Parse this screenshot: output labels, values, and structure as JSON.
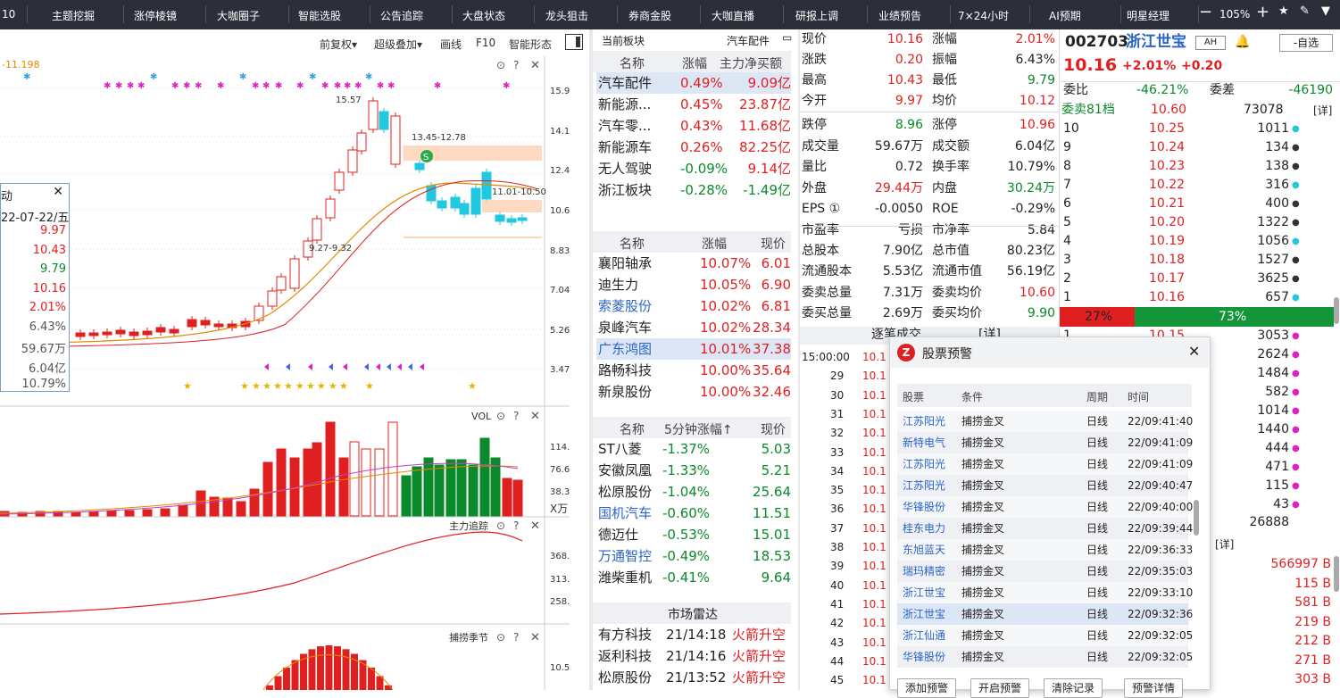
{
  "menu": [
    "10",
    "主题挖掘",
    "涨停棱镜",
    "大咖圈子",
    "智能选股",
    "公告追踪",
    "大盘状态",
    "龙头狙击",
    "券商金股",
    "大咖直播",
    "研报上调",
    "业绩预告",
    "7×24小时",
    "AI预期",
    "明星经理"
  ],
  "zoom": {
    "minus": "−",
    "level": "105%",
    "plus": "+"
  },
  "chart": {
    "tools": [
      "前复权▾",
      "超级叠加▾",
      "画线",
      "F10",
      "智能形态"
    ],
    "ma_label": "-11.198",
    "price_axis": [
      "15.97",
      "14.18",
      "12.40",
      "10.61",
      "8.83",
      "7.04",
      "5.26",
      "3.47"
    ],
    "annot": {
      "high": "15.57",
      "range1": "13.45-12.78",
      "range2": "11.01-10.50",
      "range3": "9.27-9.32"
    },
    "vol_label": "VOL",
    "vol_axis": [
      "114.97",
      "76.65",
      "38.32"
    ],
    "vol_unit": "X万",
    "zlzz_label": "主力追踪",
    "zlzz_axis": [
      "368.27",
      "313.43",
      "258.59"
    ],
    "blj_label": "捕捞季节",
    "blj_axis": [
      "10.50"
    ],
    "tooltip": {
      "title": "动",
      "date": "22-07-22/五",
      "vals": [
        {
          "v": "9.97",
          "c": "red"
        },
        {
          "v": "10.43",
          "c": "red"
        },
        {
          "v": "9.79",
          "c": "green"
        },
        {
          "v": "10.16",
          "c": "red"
        },
        {
          "v": "2.01%",
          "c": "red"
        },
        {
          "v": "6.43%",
          "c": "gray"
        },
        {
          "v": "59.67万",
          "c": "gray"
        },
        {
          "v": "6.04亿",
          "c": "gray"
        },
        {
          "v": "10.79%",
          "c": "gray"
        }
      ]
    }
  },
  "sector": {
    "title": "当前板块",
    "tag": "汽车配件",
    "cols": [
      "名称",
      "涨幅",
      "主力净买额"
    ],
    "rows": [
      {
        "n": "汽车配件",
        "p": "0.49%",
        "v": "9.09亿",
        "pc": "red",
        "vc": "red",
        "hl": true
      },
      {
        "n": "新能源...",
        "p": "0.45%",
        "v": "23.87亿",
        "pc": "red",
        "vc": "red"
      },
      {
        "n": "汽车零...",
        "p": "0.43%",
        "v": "11.68亿",
        "pc": "red",
        "vc": "red"
      },
      {
        "n": "新能源车",
        "p": "0.26%",
        "v": "82.25亿",
        "pc": "red",
        "vc": "red"
      },
      {
        "n": "无人驾驶",
        "p": "-0.09%",
        "v": "9.14亿",
        "pc": "green",
        "vc": "red"
      },
      {
        "n": "浙江板块",
        "p": "-0.28%",
        "v": "-1.49亿",
        "pc": "green",
        "vc": "green"
      }
    ]
  },
  "gainers": {
    "cols": [
      "名称",
      "涨幅",
      "现价"
    ],
    "rows": [
      {
        "n": "襄阳轴承",
        "p": "10.07%",
        "v": "6.01",
        "nc": ""
      },
      {
        "n": "迪生力",
        "p": "10.05%",
        "v": "6.90",
        "nc": ""
      },
      {
        "n": "索菱股份",
        "p": "10.02%",
        "v": "6.81",
        "nc": "blue"
      },
      {
        "n": "泉峰汽车",
        "p": "10.02%",
        "v": "28.34",
        "nc": ""
      },
      {
        "n": "广东鸿图",
        "p": "10.01%",
        "v": "37.38",
        "nc": "blue",
        "hl": true
      },
      {
        "n": "路畅科技",
        "p": "10.00%",
        "v": "35.64",
        "nc": ""
      },
      {
        "n": "新泉股份",
        "p": "10.00%",
        "v": "32.46",
        "nc": ""
      }
    ]
  },
  "fallers": {
    "cols": [
      "名称",
      "5分钟涨幅↑",
      "现价"
    ],
    "rows": [
      {
        "n": "ST八菱",
        "p": "-1.37%",
        "v": "5.03",
        "nc": ""
      },
      {
        "n": "安徽凤凰",
        "p": "-1.33%",
        "v": "5.21",
        "nc": ""
      },
      {
        "n": "松原股份",
        "p": "-1.04%",
        "v": "25.64",
        "nc": ""
      },
      {
        "n": "国机汽车",
        "p": "-0.60%",
        "v": "11.51",
        "nc": "blue"
      },
      {
        "n": "德迈仕",
        "p": "-0.53%",
        "v": "15.01",
        "nc": ""
      },
      {
        "n": "万通智控",
        "p": "-0.49%",
        "v": "18.53",
        "nc": "blue"
      },
      {
        "n": "潍柴重机",
        "p": "-0.41%",
        "v": "9.64",
        "nc": ""
      }
    ]
  },
  "radar": {
    "title": "市场雷达",
    "rows": [
      {
        "n": "有方科技",
        "t": "21/14:18",
        "e": "火箭升空"
      },
      {
        "n": "返利科技",
        "t": "21/14:16",
        "e": "火箭升空"
      },
      {
        "n": "松原股份",
        "t": "21/13:52",
        "e": "火箭升空"
      }
    ]
  },
  "quote": {
    "left": [
      {
        "k": "现价",
        "v": "10.16",
        "c": "red"
      },
      {
        "k": "涨跌",
        "v": "0.20",
        "c": "red"
      },
      {
        "k": "最高",
        "v": "10.43",
        "c": "red"
      },
      {
        "k": "今开",
        "v": "9.97",
        "c": "red"
      },
      {
        "k": "跌停",
        "v": "8.96",
        "c": "green"
      },
      {
        "k": "成交量",
        "v": "59.67万",
        "c": ""
      },
      {
        "k": "量比",
        "v": "0.72",
        "c": ""
      },
      {
        "k": "外盘",
        "v": "29.44万",
        "c": "red"
      },
      {
        "k": "EPS ①",
        "v": "-0.0050",
        "c": ""
      },
      {
        "k": "市盈率",
        "v": "亏损",
        "c": ""
      },
      {
        "k": "总股本",
        "v": "7.90亿",
        "c": ""
      },
      {
        "k": "流通股本",
        "v": "5.53亿",
        "c": ""
      },
      {
        "k": "委卖总量",
        "v": "7.31万",
        "c": ""
      },
      {
        "k": "委买总量",
        "v": "2.69万",
        "c": ""
      }
    ],
    "right": [
      {
        "k": "涨幅",
        "v": "2.01%",
        "c": "red"
      },
      {
        "k": "振幅",
        "v": "6.43%",
        "c": ""
      },
      {
        "k": "最低",
        "v": "9.79",
        "c": "green"
      },
      {
        "k": "均价",
        "v": "10.12",
        "c": "red"
      },
      {
        "k": "涨停",
        "v": "10.96",
        "c": "red"
      },
      {
        "k": "成交额",
        "v": "6.04亿",
        "c": ""
      },
      {
        "k": "换手率",
        "v": "10.79%",
        "c": ""
      },
      {
        "k": "内盘",
        "v": "30.24万",
        "c": "green"
      },
      {
        "k": "ROE",
        "v": "-0.29%",
        "c": ""
      },
      {
        "k": "市净率",
        "v": "5.84",
        "c": ""
      },
      {
        "k": "总市值",
        "v": "80.23亿",
        "c": ""
      },
      {
        "k": "流通市值",
        "v": "56.19亿",
        "c": ""
      },
      {
        "k": "委卖均价",
        "v": "10.60",
        "c": "red"
      },
      {
        "k": "委买均价",
        "v": "9.90",
        "c": "green"
      }
    ],
    "ticks_title": "逐笔成交",
    "ticks_tag": "[详]",
    "tick_times": [
      "15:00:00",
      "29",
      "30",
      "31",
      "32",
      "33",
      "34",
      "35",
      "36",
      "37",
      "38",
      "39",
      "40",
      "41",
      "42",
      "43",
      "44",
      "45"
    ],
    "tick_price": "10.1"
  },
  "stock": {
    "code": "002703",
    "name": "浙江世宝",
    "ah": "AH",
    "watch": "-自选",
    "price": "10.16",
    "pct": "+2.01%",
    "chg": "+0.20",
    "wb_k": "委比",
    "wb_v": "-46.21%",
    "wc_k": "委差",
    "wc_v": "-46190",
    "ask_total_k": "委卖81档",
    "ask_total_p": "10.60",
    "ask_total_v": "73078",
    "detail": "[详]",
    "asks": [
      [
        "10",
        "10.25",
        "1011"
      ],
      [
        "9",
        "10.24",
        "134"
      ],
      [
        "8",
        "10.23",
        "138"
      ],
      [
        "7",
        "10.22",
        "316"
      ],
      [
        "6",
        "10.21",
        "400"
      ],
      [
        "5",
        "10.20",
        "1322"
      ],
      [
        "4",
        "10.19",
        "1056"
      ],
      [
        "3",
        "10.18",
        "1527"
      ],
      [
        "2",
        "10.17",
        "3625"
      ],
      [
        "1",
        "10.16",
        "657"
      ]
    ],
    "ratio_red": "27%",
    "ratio_green": "73%",
    "bids": [
      [
        "1",
        "10.15",
        "3053"
      ],
      [
        "",
        "",
        "2624"
      ],
      [
        "",
        "",
        "1484"
      ],
      [
        "",
        "",
        "582"
      ],
      [
        "",
        "",
        "1014"
      ],
      [
        "",
        "",
        "1440"
      ],
      [
        "",
        "",
        "444"
      ],
      [
        "",
        "",
        "471"
      ],
      [
        "",
        "",
        "115"
      ],
      [
        "",
        "",
        "43"
      ]
    ],
    "bid_total": "26888",
    "big": [
      "566997 B",
      "115 B",
      "581 B",
      "219 B",
      "212 B",
      "271 B",
      "303 B"
    ]
  },
  "alert": {
    "title": "股票预警",
    "close": "✕",
    "cols": [
      "股票",
      "条件",
      "周期",
      "时间"
    ],
    "rows": [
      [
        "江苏阳光",
        "捕捞金叉",
        "日线",
        "22/09:41:40"
      ],
      [
        "新特电气",
        "捕捞金叉",
        "日线",
        "22/09:41:09"
      ],
      [
        "江苏阳光",
        "捕捞金叉",
        "日线",
        "22/09:41:09"
      ],
      [
        "江苏阳光",
        "捕捞金叉",
        "日线",
        "22/09:40:47"
      ],
      [
        "华锋股份",
        "捕捞金叉",
        "日线",
        "22/09:40:00"
      ],
      [
        "桂东电力",
        "捕捞金叉",
        "日线",
        "22/09:39:44"
      ],
      [
        "东旭蓝天",
        "捕捞金叉",
        "日线",
        "22/09:36:33"
      ],
      [
        "瑞玛精密",
        "捕捞金叉",
        "日线",
        "22/09:35:03"
      ],
      [
        "浙江世宝",
        "捕捞金叉",
        "日线",
        "22/09:33:10"
      ],
      [
        "浙江世宝",
        "捕捞金叉",
        "日线",
        "22/09:32:36"
      ],
      [
        "浙江仙通",
        "捕捞金叉",
        "日线",
        "22/09:32:05"
      ],
      [
        "华锋股份",
        "捕捞金叉",
        "日线",
        "22/09:32:05"
      ]
    ],
    "buttons": [
      "添加预警",
      "开启预警",
      "清除记录",
      "预警详情"
    ]
  }
}
